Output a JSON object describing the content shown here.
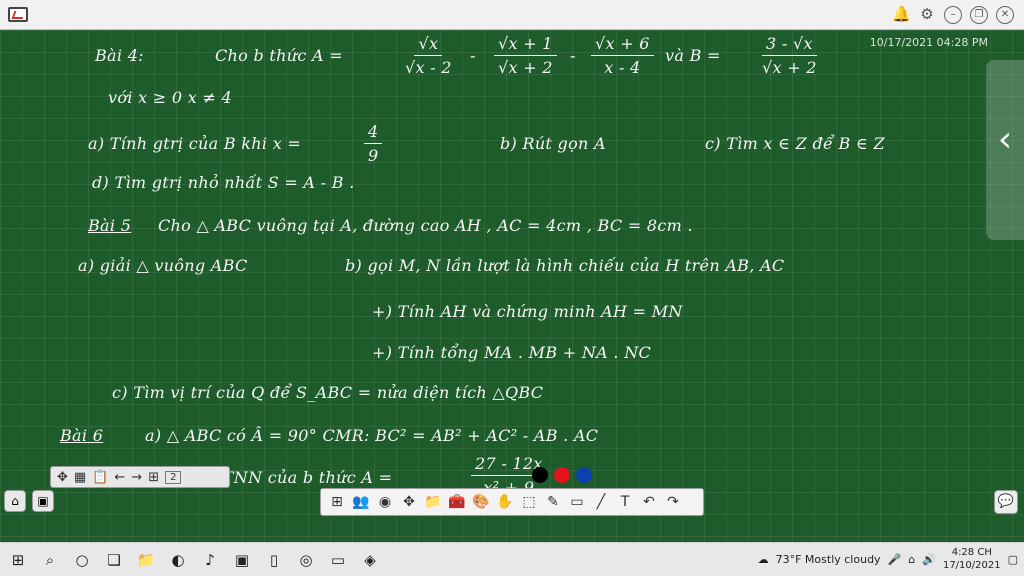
{
  "topbar": {
    "icons": [
      "bell-icon",
      "gear-icon",
      "minimize-icon",
      "restore-icon",
      "close-icon"
    ]
  },
  "board": {
    "timestamp": "10/17/2021 04:28 PM",
    "lines": {
      "l1a": "Bài 4:",
      "l1b": "Cho b thức A =",
      "f1n": "√x",
      "f1d": "√x - 2",
      "l1c": "-",
      "f2n": "√x + 1",
      "f2d": "√x + 2",
      "l1d": "-",
      "f3n": "√x + 6",
      "f3d": "x - 4",
      "l1e": "và B =",
      "f4n": "3 - √x",
      "f4d": "√x + 2",
      "l2": "với x ≥ 0   x ≠ 4",
      "l3a": "a) Tính gtrị của B khi x =",
      "f5n": "4",
      "f5d": "9",
      "l3b": "b) Rút gọn A",
      "l3c": "c) Tìm x ∈ Z để B ∈ Z",
      "l4": "d) Tìm gtrị nhỏ nhất   S = A - B .",
      "l5a": "Bài 5",
      "l5b": "Cho △ ABC vuông tại A, đường cao AH , AC = 4cm , BC = 8cm .",
      "l6a": "a) giải △ vuông ABC",
      "l6b": "b) gọi M, N lần lượt là hình chiếu của H trên AB, AC",
      "l7": "+) Tính AH và chứng minh AH = MN",
      "l8": "+) Tính tổng MA . MB + NA . NC",
      "l9": "c) Tìm vị trí của Q để S_ABC = nửa diện tích △QBC",
      "l10a": "Bài 6",
      "l10b": "a) △ ABC có Â = 90°   CMR: BC² = AB² + AC² - AB . AC",
      "l11a": "b) Tìm GTNN của b thức A =",
      "f6n": "27 - 12x",
      "f6d": "x² + 9"
    }
  },
  "mini_toolbar": {
    "page_count": "2"
  },
  "pen_colors": [
    "#000000",
    "#e0141a",
    "#0a3fae"
  ],
  "taskbar": {
    "weather": "73°F Mostly cloudy",
    "time": "4:28 CH",
    "date": "17/10/2021"
  }
}
